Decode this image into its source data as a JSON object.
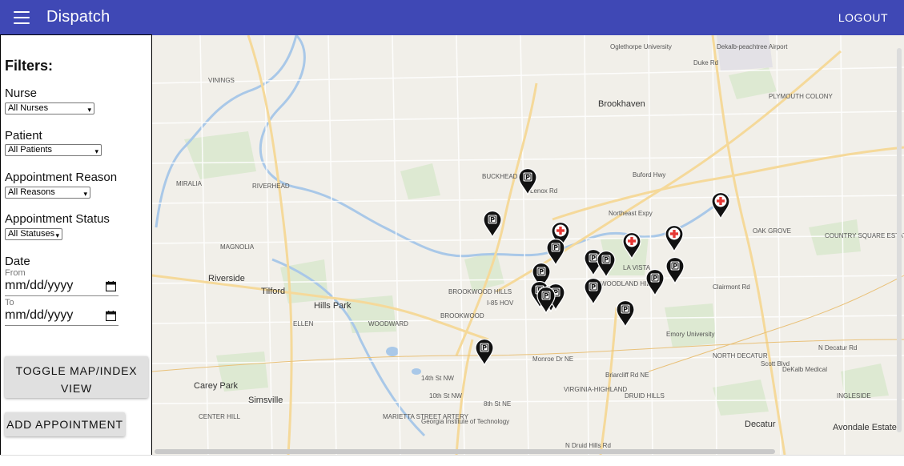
{
  "app": {
    "title": "Dispatch",
    "logout_label": "LOGOUT"
  },
  "filters": {
    "heading": "Filters:",
    "nurse": {
      "label": "Nurse",
      "selected": "All Nurses"
    },
    "patient": {
      "label": "Patient",
      "selected": "All Patients"
    },
    "reason": {
      "label": "Appointment Reason",
      "selected": "All Reasons"
    },
    "status": {
      "label": "Appointment Status",
      "selected": "All Statuses"
    },
    "date": {
      "label": "Date",
      "from_label": "From",
      "from_value": "mm/dd/yyyy",
      "to_label": "To",
      "to_value": "mm/dd/yyyy"
    }
  },
  "buttons": {
    "toggle_line1": "TOGGLE MAP/INDEX",
    "toggle_line2": "VIEW",
    "add": "ADD APPOINTMENT"
  },
  "map_labels": [
    "Oglethorpe University",
    "Dekalb-peachtree Airport",
    "Brookhaven",
    "PLYMOUTH COLONY",
    "VININGS",
    "RIVERHEAD",
    "MIRALIA",
    "BUCKHEAD",
    "MAGNOLIA",
    "OAK GROVE",
    "COUNTRY SQUARE ESTATES",
    "LA VISTA",
    "WOODLAND HILLS",
    "Riverside",
    "Tilford",
    "Hills Park",
    "BROOKWOOD HILLS",
    "BROOKWOOD",
    "ELLEN",
    "WOODWARD",
    "Emory University",
    "NORTH DECATUR",
    "DeKalb Medical",
    "Carey Park",
    "Simsville",
    "VIRGINIA-HIGHLAND",
    "DRUID HILLS",
    "CENTER HILL",
    "MARIETTA STREET ARTERY",
    "Georgia Institute of Technology",
    "Decatur",
    "Avondale Estates",
    "INGLESIDE",
    "14th St NW",
    "10th St NW",
    "8th St NE",
    "Duke Rd",
    "Lenox Rd",
    "Buford Hwy",
    "Northeast Expy",
    "N Decatur Rd",
    "Clairmont Rd",
    "Scott Blvd",
    "Briarcliff Rd NE",
    "Monroe Dr NE",
    "I-85 HOV",
    "N Druid Hills Rd"
  ],
  "markers": [
    {
      "type": "appointment",
      "icon": "parking-marker-icon"
    },
    {
      "type": "appointment",
      "icon": "parking-marker-icon"
    },
    {
      "type": "hospital",
      "icon": "hospital-marker-icon"
    },
    {
      "type": "appointment",
      "icon": "parking-marker-icon"
    },
    {
      "type": "hospital",
      "icon": "hospital-marker-icon"
    },
    {
      "type": "hospital",
      "icon": "hospital-marker-icon"
    },
    {
      "type": "hospital",
      "icon": "hospital-marker-icon"
    },
    {
      "type": "appointment",
      "icon": "parking-marker-icon"
    },
    {
      "type": "appointment",
      "icon": "parking-marker-icon"
    },
    {
      "type": "appointment",
      "icon": "parking-marker-icon"
    },
    {
      "type": "appointment",
      "icon": "parking-marker-icon"
    },
    {
      "type": "appointment",
      "icon": "parking-marker-icon"
    },
    {
      "type": "appointment",
      "icon": "parking-marker-icon"
    },
    {
      "type": "appointment",
      "icon": "parking-marker-icon"
    },
    {
      "type": "appointment",
      "icon": "parking-marker-icon"
    },
    {
      "type": "appointment",
      "icon": "parking-marker-icon"
    },
    {
      "type": "appointment",
      "icon": "parking-marker-icon"
    },
    {
      "type": "appointment",
      "icon": "parking-marker-icon"
    },
    {
      "type": "appointment",
      "icon": "parking-marker-icon"
    }
  ],
  "colors": {
    "appbar": "#3f48b5",
    "marker": "#111111",
    "hospital_cross": "#e53935"
  }
}
